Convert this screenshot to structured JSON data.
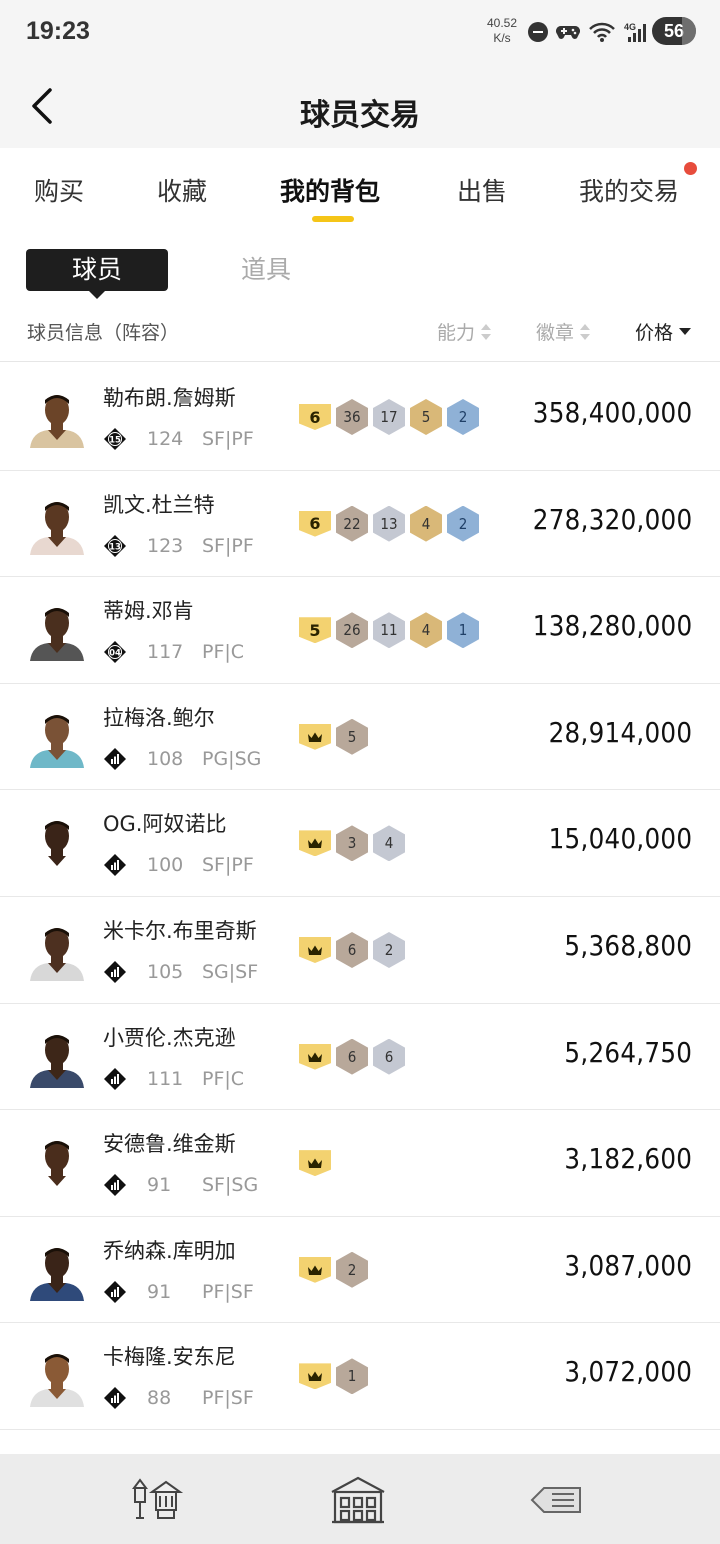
{
  "status_bar": {
    "time": "19:23",
    "net_speed_value": "40.52",
    "net_speed_unit": "K/s",
    "battery": "56"
  },
  "header": {
    "title": "球员交易"
  },
  "tabs": [
    {
      "label": "购买"
    },
    {
      "label": "收藏"
    },
    {
      "label": "我的背包"
    },
    {
      "label": "出售"
    },
    {
      "label": "我的交易"
    }
  ],
  "subtabs": [
    {
      "label": "球员"
    },
    {
      "label": "道具"
    }
  ],
  "columns": {
    "info": "球员信息（阵容）",
    "ability": "能力",
    "badges": "徽章",
    "price": "价格"
  },
  "colors": {
    "accent": "#f5c518",
    "notification": "#e74c3c",
    "rank_badge": "#f3d270"
  },
  "players": [
    {
      "name": "勒布朗.詹姆斯",
      "tier": "15",
      "ovr": "124",
      "pos": "SF|PF",
      "rank": "6",
      "badges": [
        {
          "type": "hof",
          "n": "36"
        },
        {
          "type": "silver",
          "n": "17"
        },
        {
          "type": "gold",
          "n": "5"
        },
        {
          "type": "blue",
          "n": "2"
        }
      ],
      "price": "358,400,000",
      "skin": "#6b4428",
      "jersey": "#d9c4a0"
    },
    {
      "name": "凯文.杜兰特",
      "tier": "13",
      "ovr": "123",
      "pos": "SF|PF",
      "rank": "6",
      "badges": [
        {
          "type": "hof",
          "n": "22"
        },
        {
          "type": "silver",
          "n": "13"
        },
        {
          "type": "gold",
          "n": "4"
        },
        {
          "type": "blue",
          "n": "2"
        }
      ],
      "price": "278,320,000",
      "skin": "#5a3822",
      "jersey": "#e8d8d0"
    },
    {
      "name": "蒂姆.邓肯",
      "tier": "04",
      "ovr": "117",
      "pos": "PF|C",
      "rank": "5",
      "badges": [
        {
          "type": "hof",
          "n": "26"
        },
        {
          "type": "silver",
          "n": "11"
        },
        {
          "type": "gold",
          "n": "4"
        },
        {
          "type": "blue",
          "n": "1"
        }
      ],
      "price": "138,280,000",
      "skin": "#4a2f1e",
      "jersey": "#555555"
    },
    {
      "name": "拉梅洛.鲍尔",
      "tier": "",
      "ovr": "108",
      "pos": "PG|SG",
      "rank": "crown",
      "badges": [
        {
          "type": "hof",
          "n": "5"
        }
      ],
      "price": "28,914,000",
      "skin": "#7a5236",
      "jersey": "#6fb8c8"
    },
    {
      "name": "OG.阿奴诺比",
      "tier": "",
      "ovr": "100",
      "pos": "SF|PF",
      "rank": "crown",
      "badges": [
        {
          "type": "hof",
          "n": "3"
        },
        {
          "type": "silver",
          "n": "4"
        }
      ],
      "price": "15,040,000",
      "skin": "#3a2418",
      "jersey": "#ffffff"
    },
    {
      "name": "米卡尔.布里奇斯",
      "tier": "",
      "ovr": "105",
      "pos": "SG|SF",
      "rank": "crown",
      "badges": [
        {
          "type": "hof",
          "n": "6"
        },
        {
          "type": "silver",
          "n": "2"
        }
      ],
      "price": "5,368,800",
      "skin": "#4d3020",
      "jersey": "#d8d8d8"
    },
    {
      "name": "小贾伦.杰克逊",
      "tier": "",
      "ovr": "111",
      "pos": "PF|C",
      "rank": "crown",
      "badges": [
        {
          "type": "hof",
          "n": "6"
        },
        {
          "type": "silver",
          "n": "6"
        }
      ],
      "price": "5,264,750",
      "skin": "#3d2618",
      "jersey": "#3a4a6a"
    },
    {
      "name": "安德鲁.维金斯",
      "tier": "",
      "ovr": "91",
      "pos": "SF|SG",
      "rank": "crown",
      "badges": [],
      "price": "3,182,600",
      "skin": "#4a2d1c",
      "jersey": "#ffffff"
    },
    {
      "name": "乔纳森.库明加",
      "tier": "",
      "ovr": "91",
      "pos": "PF|SF",
      "rank": "crown",
      "badges": [
        {
          "type": "hof",
          "n": "2"
        }
      ],
      "price": "3,087,000",
      "skin": "#3a2418",
      "jersey": "#2f4a7a"
    },
    {
      "name": "卡梅隆.安东尼",
      "tier": "",
      "ovr": "88",
      "pos": "PF|SF",
      "rank": "crown",
      "badges": [
        {
          "type": "hof",
          "n": "1"
        }
      ],
      "price": "3,072,000",
      "skin": "#8a5a36",
      "jersey": "#e0e0e0"
    }
  ],
  "bottom_nav": [
    {
      "icon": "lanterns-icon"
    },
    {
      "icon": "building-icon"
    },
    {
      "icon": "ticket-arrow-icon"
    }
  ]
}
